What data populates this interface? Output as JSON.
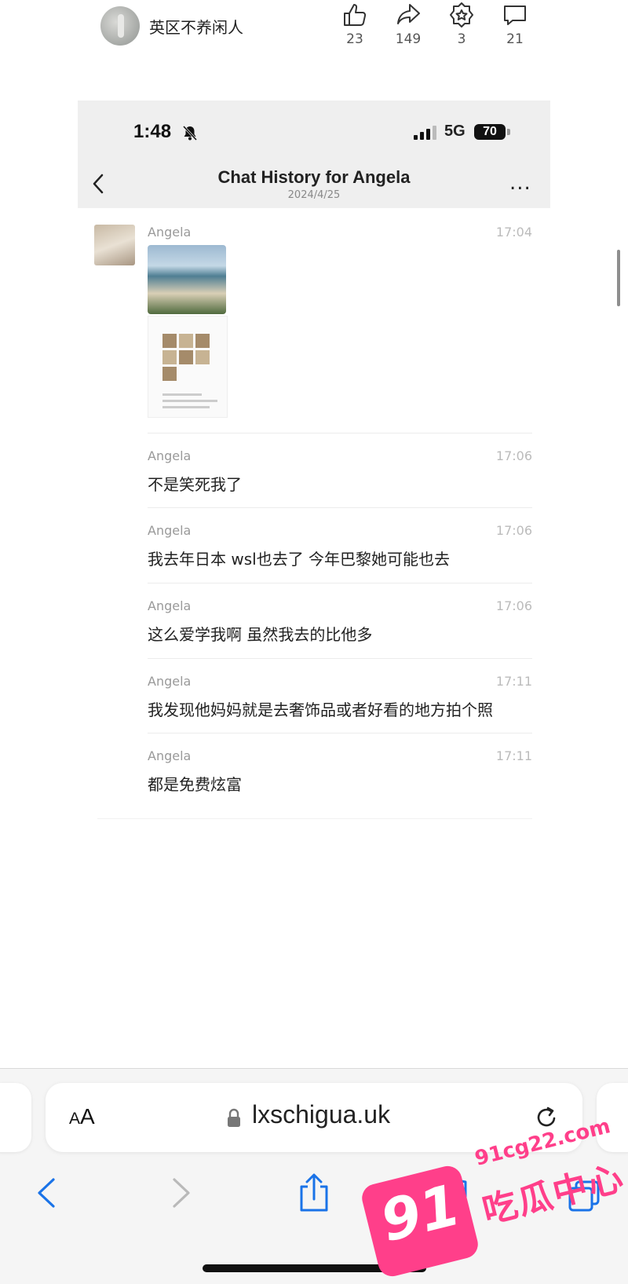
{
  "author": {
    "name": "英区不养闲人"
  },
  "stats": [
    {
      "icon": "thumbs-up-icon",
      "count": "23"
    },
    {
      "icon": "share-icon",
      "count": "149"
    },
    {
      "icon": "badge-star-icon",
      "count": "3"
    },
    {
      "icon": "comment-icon",
      "count": "21"
    }
  ],
  "phone": {
    "time": "1:48",
    "network": "5G",
    "battery": "70",
    "chat_title": "Chat History for Angela",
    "chat_date": "2024/4/25",
    "more": "..."
  },
  "messages": [
    {
      "sender": "Angela",
      "time": "17:04",
      "text": ""
    },
    {
      "sender": "Angela",
      "time": "17:06",
      "text": "不是笑死我了"
    },
    {
      "sender": "Angela",
      "time": "17:06",
      "text": "我去年日本 wsl也去了 今年巴黎她可能也去"
    },
    {
      "sender": "Angela",
      "time": "17:06",
      "text": "这么爱学我啊 虽然我去的比他多"
    },
    {
      "sender": "Angela",
      "time": "17:11",
      "text": "我发现他妈妈就是去奢饰品或者好看的地方拍个照"
    },
    {
      "sender": "Angela",
      "time": "17:11",
      "text": "都是免费炫富"
    }
  ],
  "browser": {
    "aa_big": "A",
    "aa_small": "A",
    "url": "lxschigua.uk"
  },
  "watermark": {
    "number": "91",
    "domain": "91cg22.com",
    "name": "吃瓜中心"
  },
  "colors": {
    "accent": "#1a73e8",
    "watermark": "#ff3f8a"
  }
}
